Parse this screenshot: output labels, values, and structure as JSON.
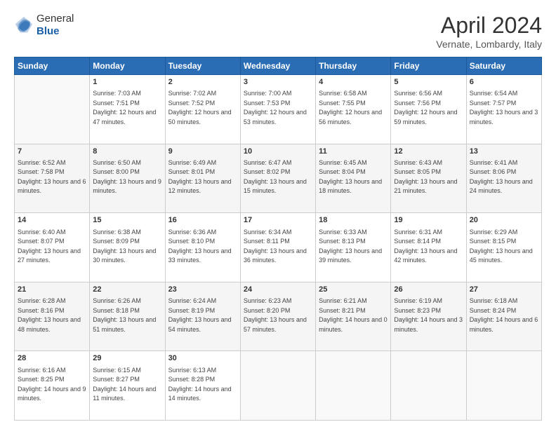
{
  "header": {
    "logo_general": "General",
    "logo_blue": "Blue",
    "month": "April 2024",
    "location": "Vernate, Lombardy, Italy"
  },
  "weekdays": [
    "Sunday",
    "Monday",
    "Tuesday",
    "Wednesday",
    "Thursday",
    "Friday",
    "Saturday"
  ],
  "weeks": [
    [
      {
        "day": "",
        "sunrise": "",
        "sunset": "",
        "daylight": ""
      },
      {
        "day": "1",
        "sunrise": "Sunrise: 7:03 AM",
        "sunset": "Sunset: 7:51 PM",
        "daylight": "Daylight: 12 hours and 47 minutes."
      },
      {
        "day": "2",
        "sunrise": "Sunrise: 7:02 AM",
        "sunset": "Sunset: 7:52 PM",
        "daylight": "Daylight: 12 hours and 50 minutes."
      },
      {
        "day": "3",
        "sunrise": "Sunrise: 7:00 AM",
        "sunset": "Sunset: 7:53 PM",
        "daylight": "Daylight: 12 hours and 53 minutes."
      },
      {
        "day": "4",
        "sunrise": "Sunrise: 6:58 AM",
        "sunset": "Sunset: 7:55 PM",
        "daylight": "Daylight: 12 hours and 56 minutes."
      },
      {
        "day": "5",
        "sunrise": "Sunrise: 6:56 AM",
        "sunset": "Sunset: 7:56 PM",
        "daylight": "Daylight: 12 hours and 59 minutes."
      },
      {
        "day": "6",
        "sunrise": "Sunrise: 6:54 AM",
        "sunset": "Sunset: 7:57 PM",
        "daylight": "Daylight: 13 hours and 3 minutes."
      }
    ],
    [
      {
        "day": "7",
        "sunrise": "Sunrise: 6:52 AM",
        "sunset": "Sunset: 7:58 PM",
        "daylight": "Daylight: 13 hours and 6 minutes."
      },
      {
        "day": "8",
        "sunrise": "Sunrise: 6:50 AM",
        "sunset": "Sunset: 8:00 PM",
        "daylight": "Daylight: 13 hours and 9 minutes."
      },
      {
        "day": "9",
        "sunrise": "Sunrise: 6:49 AM",
        "sunset": "Sunset: 8:01 PM",
        "daylight": "Daylight: 13 hours and 12 minutes."
      },
      {
        "day": "10",
        "sunrise": "Sunrise: 6:47 AM",
        "sunset": "Sunset: 8:02 PM",
        "daylight": "Daylight: 13 hours and 15 minutes."
      },
      {
        "day": "11",
        "sunrise": "Sunrise: 6:45 AM",
        "sunset": "Sunset: 8:04 PM",
        "daylight": "Daylight: 13 hours and 18 minutes."
      },
      {
        "day": "12",
        "sunrise": "Sunrise: 6:43 AM",
        "sunset": "Sunset: 8:05 PM",
        "daylight": "Daylight: 13 hours and 21 minutes."
      },
      {
        "day": "13",
        "sunrise": "Sunrise: 6:41 AM",
        "sunset": "Sunset: 8:06 PM",
        "daylight": "Daylight: 13 hours and 24 minutes."
      }
    ],
    [
      {
        "day": "14",
        "sunrise": "Sunrise: 6:40 AM",
        "sunset": "Sunset: 8:07 PM",
        "daylight": "Daylight: 13 hours and 27 minutes."
      },
      {
        "day": "15",
        "sunrise": "Sunrise: 6:38 AM",
        "sunset": "Sunset: 8:09 PM",
        "daylight": "Daylight: 13 hours and 30 minutes."
      },
      {
        "day": "16",
        "sunrise": "Sunrise: 6:36 AM",
        "sunset": "Sunset: 8:10 PM",
        "daylight": "Daylight: 13 hours and 33 minutes."
      },
      {
        "day": "17",
        "sunrise": "Sunrise: 6:34 AM",
        "sunset": "Sunset: 8:11 PM",
        "daylight": "Daylight: 13 hours and 36 minutes."
      },
      {
        "day": "18",
        "sunrise": "Sunrise: 6:33 AM",
        "sunset": "Sunset: 8:13 PM",
        "daylight": "Daylight: 13 hours and 39 minutes."
      },
      {
        "day": "19",
        "sunrise": "Sunrise: 6:31 AM",
        "sunset": "Sunset: 8:14 PM",
        "daylight": "Daylight: 13 hours and 42 minutes."
      },
      {
        "day": "20",
        "sunrise": "Sunrise: 6:29 AM",
        "sunset": "Sunset: 8:15 PM",
        "daylight": "Daylight: 13 hours and 45 minutes."
      }
    ],
    [
      {
        "day": "21",
        "sunrise": "Sunrise: 6:28 AM",
        "sunset": "Sunset: 8:16 PM",
        "daylight": "Daylight: 13 hours and 48 minutes."
      },
      {
        "day": "22",
        "sunrise": "Sunrise: 6:26 AM",
        "sunset": "Sunset: 8:18 PM",
        "daylight": "Daylight: 13 hours and 51 minutes."
      },
      {
        "day": "23",
        "sunrise": "Sunrise: 6:24 AM",
        "sunset": "Sunset: 8:19 PM",
        "daylight": "Daylight: 13 hours and 54 minutes."
      },
      {
        "day": "24",
        "sunrise": "Sunrise: 6:23 AM",
        "sunset": "Sunset: 8:20 PM",
        "daylight": "Daylight: 13 hours and 57 minutes."
      },
      {
        "day": "25",
        "sunrise": "Sunrise: 6:21 AM",
        "sunset": "Sunset: 8:21 PM",
        "daylight": "Daylight: 14 hours and 0 minutes."
      },
      {
        "day": "26",
        "sunrise": "Sunrise: 6:19 AM",
        "sunset": "Sunset: 8:23 PM",
        "daylight": "Daylight: 14 hours and 3 minutes."
      },
      {
        "day": "27",
        "sunrise": "Sunrise: 6:18 AM",
        "sunset": "Sunset: 8:24 PM",
        "daylight": "Daylight: 14 hours and 6 minutes."
      }
    ],
    [
      {
        "day": "28",
        "sunrise": "Sunrise: 6:16 AM",
        "sunset": "Sunset: 8:25 PM",
        "daylight": "Daylight: 14 hours and 9 minutes."
      },
      {
        "day": "29",
        "sunrise": "Sunrise: 6:15 AM",
        "sunset": "Sunset: 8:27 PM",
        "daylight": "Daylight: 14 hours and 11 minutes."
      },
      {
        "day": "30",
        "sunrise": "Sunrise: 6:13 AM",
        "sunset": "Sunset: 8:28 PM",
        "daylight": "Daylight: 14 hours and 14 minutes."
      },
      {
        "day": "",
        "sunrise": "",
        "sunset": "",
        "daylight": ""
      },
      {
        "day": "",
        "sunrise": "",
        "sunset": "",
        "daylight": ""
      },
      {
        "day": "",
        "sunrise": "",
        "sunset": "",
        "daylight": ""
      },
      {
        "day": "",
        "sunrise": "",
        "sunset": "",
        "daylight": ""
      }
    ]
  ]
}
